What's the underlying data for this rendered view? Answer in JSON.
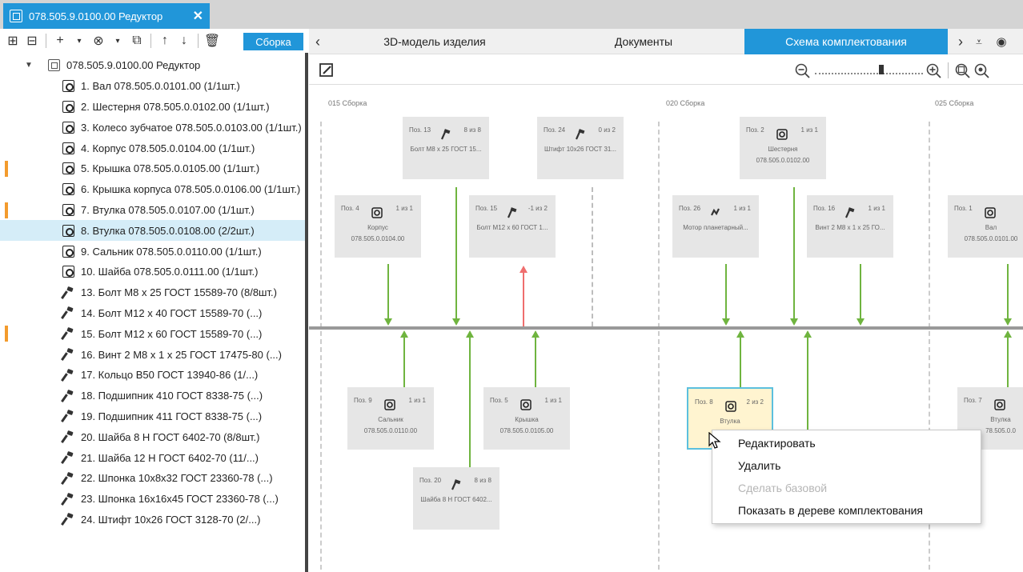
{
  "window": {
    "tab_title": "078.505.9.0100.00 Редуктор",
    "close_glyph": "✕"
  },
  "left_toolbar": {
    "assembly_button": "Сборка"
  },
  "tree": {
    "root": "078.505.9.0100.00 Редуктор",
    "items": [
      {
        "label": "1. Вал 078.505.0.0101.00 (1/1шт.)",
        "icon": "part-icon",
        "marked": false
      },
      {
        "label": "2. Шестерня 078.505.0.0102.00 (1/1шт.)",
        "icon": "part-icon",
        "marked": false
      },
      {
        "label": "3. Колесо зубчатое 078.505.0.0103.00 (1/1шт.)",
        "icon": "part-icon",
        "marked": false
      },
      {
        "label": "4. Корпус 078.505.0.0104.00 (1/1шт.)",
        "icon": "part-icon",
        "marked": false
      },
      {
        "label": "5. Крышка 078.505.0.0105.00 (1/1шт.)",
        "icon": "part-icon",
        "marked": true
      },
      {
        "label": "6. Крышка корпуса 078.505.0.0106.00 (1/1шт.)",
        "icon": "part-icon",
        "marked": false
      },
      {
        "label": "7. Втулка 078.505.0.0107.00 (1/1шт.)",
        "icon": "part-icon",
        "marked": true
      },
      {
        "label": "8. Втулка 078.505.0.0108.00 (2/2шт.)",
        "icon": "part-icon",
        "marked": false,
        "selected": true
      },
      {
        "label": "9. Сальник 078.505.0.0110.00 (1/1шт.)",
        "icon": "part-icon",
        "marked": false
      },
      {
        "label": "10. Шайба 078.505.0.0111.00 (1/1шт.)",
        "icon": "part-icon",
        "marked": false
      },
      {
        "label": "13. Болт М8 x 25 ГОСТ 15589-70 (8/8шт.)",
        "icon": "standard-part-icon",
        "marked": false
      },
      {
        "label": "14. Болт М12 x 40 ГОСТ 15589-70 (...)",
        "icon": "standard-part-icon",
        "marked": false
      },
      {
        "label": "15. Болт М12 x 60 ГОСТ 15589-70 (...)",
        "icon": "standard-part-icon",
        "marked": true
      },
      {
        "label": "16. Винт 2 М8 x 1 x 25 ГОСТ 17475-80 (...)",
        "icon": "standard-part-icon",
        "marked": false
      },
      {
        "label": "17. Кольцо B50 ГОСТ 13940-86 (1/...)",
        "icon": "standard-part-icon",
        "marked": false
      },
      {
        "label": "18. Подшипник 410 ГОСТ 8338-75 (...)",
        "icon": "standard-part-icon",
        "marked": false
      },
      {
        "label": "19. Подшипник 411 ГОСТ 8338-75 (...)",
        "icon": "standard-part-icon",
        "marked": false
      },
      {
        "label": "20. Шайба 8 Н ГОСТ 6402-70 (8/8шт.)",
        "icon": "standard-part-icon",
        "marked": false
      },
      {
        "label": "21. Шайба 12 Н ГОСТ 6402-70 (11/...)",
        "icon": "standard-part-icon",
        "marked": false
      },
      {
        "label": "22. Шпонка 10x8x32 ГОСТ 23360-78 (...)",
        "icon": "standard-part-icon",
        "marked": false
      },
      {
        "label": "23. Шпонка 16x16x45 ГОСТ 23360-78 (...)",
        "icon": "standard-part-icon",
        "marked": false
      },
      {
        "label": "24. Штифт 10x26 ГОСТ 3128-70 (2/...)",
        "icon": "standard-part-icon",
        "marked": false
      }
    ]
  },
  "tabs": [
    "3D-модель изделия",
    "Документы",
    "Схема комплектования"
  ],
  "active_tab": "Схема комплектования",
  "scheme": {
    "stages": [
      "015 Сборка",
      "020 Сборка",
      "025 Сборка"
    ],
    "nodes": [
      {
        "pos": "Поз. 13",
        "count": "8 из 8",
        "name": "Болт М8 x 25 ГОСТ 15...",
        "code": ""
      },
      {
        "pos": "Поз. 24",
        "count": "0 из 2",
        "name": "Штифт 10x26 ГОСТ 31...",
        "code": ""
      },
      {
        "pos": "Поз. 4",
        "count": "1 из 1",
        "name": "Корпус",
        "code": "078.505.0.0104.00"
      },
      {
        "pos": "Поз. 15",
        "count": "-1 из 2",
        "name": "Болт М12 x 60 ГОСТ 1...",
        "code": ""
      },
      {
        "pos": "Поз. 2",
        "count": "1 из 1",
        "name": "Шестерня",
        "code": "078.505.0.0102.00"
      },
      {
        "pos": "Поз. 26",
        "count": "1 из 1",
        "name": "Мотор планетарный...",
        "code": ""
      },
      {
        "pos": "Поз. 16",
        "count": "1 из 1",
        "name": "Винт 2 М8 x 1 x 25 ГО...",
        "code": ""
      },
      {
        "pos": "Поз. 1",
        "count": "",
        "name": "Вал",
        "code": "078.505.0.0101.00"
      },
      {
        "pos": "Поз. 9",
        "count": "1 из 1",
        "name": "Сальник",
        "code": "078.505.0.0110.00"
      },
      {
        "pos": "Поз. 5",
        "count": "1 из 1",
        "name": "Крышка",
        "code": "078.505.0.0105.00"
      },
      {
        "pos": "Поз. 8",
        "count": "2 из 2",
        "name": "Втулка",
        "code": "0"
      },
      {
        "pos": "Поз. 7",
        "count": "",
        "name": "Втулка",
        "code": "78.505.0.0"
      },
      {
        "pos": "Поз. 20",
        "count": "8 из 8",
        "name": "Шайба 8 Н ГОСТ 6402...",
        "code": ""
      }
    ]
  },
  "context_menu": {
    "items": [
      {
        "label": "Редактировать",
        "disabled": false
      },
      {
        "label": "Удалить",
        "disabled": false
      },
      {
        "label": "Сделать базовой",
        "disabled": true
      },
      {
        "label": "Показать в дереве комплектования",
        "disabled": false
      }
    ]
  },
  "colors": {
    "accent": "#2196d9",
    "connector": "#6fb43f",
    "error_connector": "#ef6e6e",
    "marker": "#f39b2d",
    "selection": "#d5edf8"
  }
}
